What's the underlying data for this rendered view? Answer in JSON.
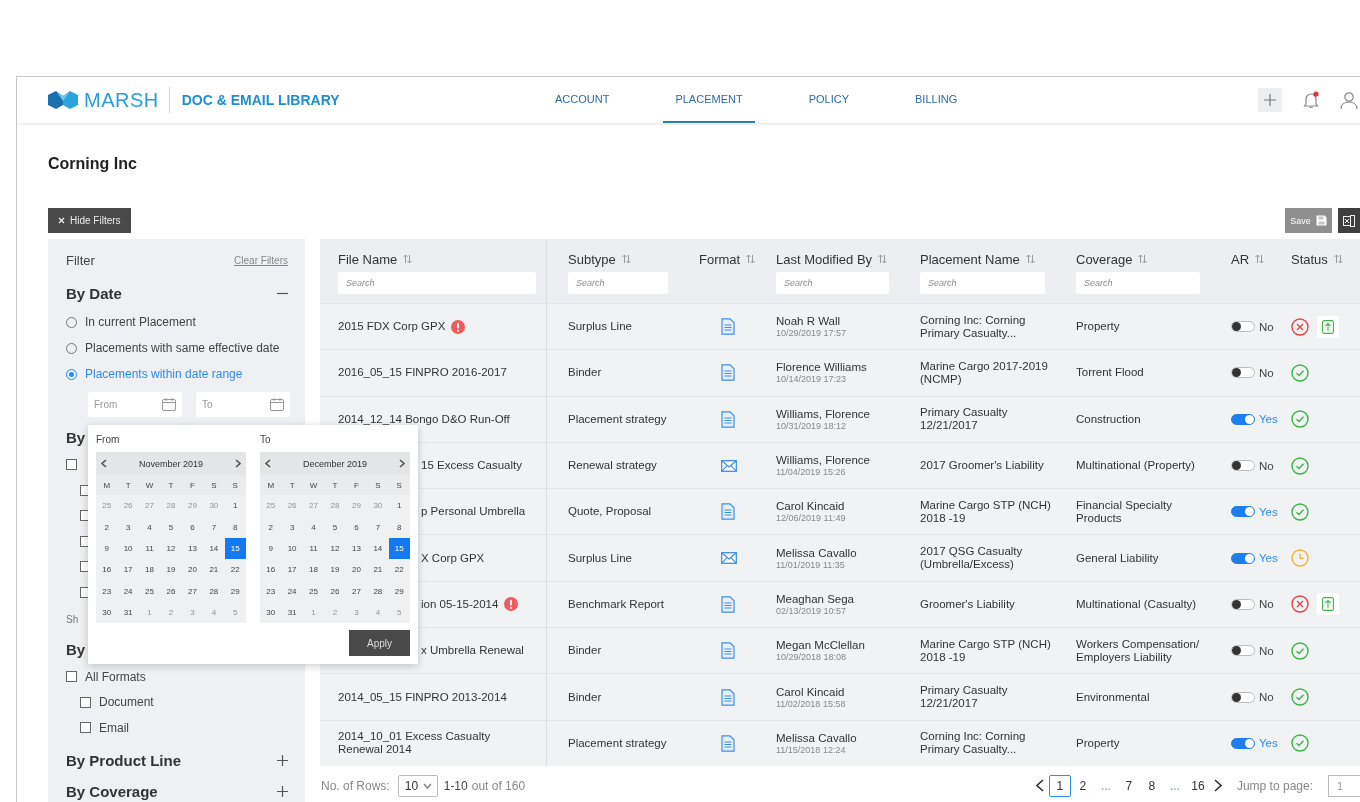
{
  "header": {
    "brand": "MARSH",
    "product": "DOC & EMAIL LIBRARY",
    "notifications": {
      "unread": true
    }
  },
  "nav": [
    {
      "label": "ACCOUNT",
      "selected": false
    },
    {
      "label": "PLACEMENT",
      "selected": true
    },
    {
      "label": "POLICY",
      "selected": false
    },
    {
      "label": "BILLING",
      "selected": false
    }
  ],
  "page_title": "Corning Inc",
  "toolbar": {
    "hide_filters": "Hide Filters",
    "save": {
      "label": "Save",
      "disabled": true
    }
  },
  "filters": {
    "title": "Filter",
    "clear": "Clear Filters",
    "sections": [
      {
        "kind": "radio",
        "title": "By Date",
        "expanded": true,
        "options": [
          {
            "label": "In current Placement",
            "selected": false
          },
          {
            "label": "Placements with same effective date",
            "selected": false
          },
          {
            "label": "Placements within date range",
            "selected": true
          }
        ],
        "range": {
          "from": {
            "placeholder": "From"
          },
          "to": {
            "placeholder": "To"
          }
        }
      },
      {
        "kind": "checkbox",
        "title": "By",
        "items": [
          {
            "checked": false,
            "children": [
              {
                "checked": false
              },
              {
                "checked": false
              },
              {
                "checked": false
              },
              {
                "checked": false
              },
              {
                "checked": false
              }
            ]
          }
        ],
        "more": "Sh"
      },
      {
        "kind": "checkbox",
        "title": "By",
        "items": [
          {
            "label": "All Formats",
            "checked": false,
            "children": [
              {
                "label": "Document",
                "checked": false
              },
              {
                "label": "Email",
                "checked": false
              }
            ]
          }
        ]
      },
      {
        "kind": "collapsed",
        "title": "By Product Line",
        "expanded": false
      },
      {
        "kind": "collapsed",
        "title": "By Coverage",
        "expanded": false
      }
    ]
  },
  "date_picker": {
    "calendars": [
      {
        "label": "From",
        "month": "November 2019",
        "weekdays": [
          "M",
          "T",
          "W",
          "T",
          "F",
          "S",
          "S"
        ],
        "weeks": [
          [
            {
              "day": "25",
              "muted": true,
              "selected": false
            },
            {
              "day": "26",
              "muted": true,
              "selected": false
            },
            {
              "day": "27",
              "muted": true,
              "selected": false
            },
            {
              "day": "28",
              "muted": true,
              "selected": false
            },
            {
              "day": "29",
              "muted": true,
              "selected": false
            },
            {
              "day": "30",
              "muted": true,
              "selected": false
            },
            {
              "day": "1",
              "muted": false,
              "selected": false
            }
          ],
          [
            {
              "day": "2",
              "muted": false,
              "selected": false
            },
            {
              "day": "3",
              "muted": false,
              "selected": false
            },
            {
              "day": "4",
              "muted": false,
              "selected": false
            },
            {
              "day": "5",
              "muted": false,
              "selected": false
            },
            {
              "day": "6",
              "muted": false,
              "selected": false
            },
            {
              "day": "7",
              "muted": false,
              "selected": false
            },
            {
              "day": "8",
              "muted": false,
              "selected": false
            }
          ],
          [
            {
              "day": "9",
              "muted": false,
              "selected": false
            },
            {
              "day": "10",
              "muted": false,
              "selected": false
            },
            {
              "day": "11",
              "muted": false,
              "selected": false
            },
            {
              "day": "12",
              "muted": false,
              "selected": false
            },
            {
              "day": "13",
              "muted": false,
              "selected": false
            },
            {
              "day": "14",
              "muted": false,
              "selected": false
            },
            {
              "day": "15",
              "muted": false,
              "selected": true
            }
          ],
          [
            {
              "day": "16",
              "muted": false,
              "selected": false
            },
            {
              "day": "17",
              "muted": false,
              "selected": false
            },
            {
              "day": "18",
              "muted": false,
              "selected": false
            },
            {
              "day": "19",
              "muted": false,
              "selected": false
            },
            {
              "day": "20",
              "muted": false,
              "selected": false
            },
            {
              "day": "21",
              "muted": false,
              "selected": false
            },
            {
              "day": "22",
              "muted": false,
              "selected": false
            }
          ],
          [
            {
              "day": "23",
              "muted": false,
              "selected": false
            },
            {
              "day": "24",
              "muted": false,
              "selected": false
            },
            {
              "day": "25",
              "muted": false,
              "selected": false
            },
            {
              "day": "26",
              "muted": false,
              "selected": false
            },
            {
              "day": "27",
              "muted": false,
              "selected": false
            },
            {
              "day": "28",
              "muted": false,
              "selected": false
            },
            {
              "day": "29",
              "muted": false,
              "selected": false
            }
          ],
          [
            {
              "day": "30",
              "muted": false,
              "selected": false
            },
            {
              "day": "31",
              "muted": false,
              "selected": false
            },
            {
              "day": "1",
              "muted": true,
              "selected": false
            },
            {
              "day": "2",
              "muted": true,
              "selected": false
            },
            {
              "day": "3",
              "muted": true,
              "selected": false
            },
            {
              "day": "4",
              "muted": true,
              "selected": false
            },
            {
              "day": "5",
              "muted": true,
              "selected": false
            }
          ]
        ]
      },
      {
        "label": "To",
        "month": "December 2019",
        "weekdays": [
          "M",
          "T",
          "W",
          "T",
          "F",
          "S",
          "S"
        ],
        "weeks": [
          [
            {
              "day": "25",
              "muted": true,
              "selected": false
            },
            {
              "day": "26",
              "muted": true,
              "selected": false
            },
            {
              "day": "27",
              "muted": true,
              "selected": false
            },
            {
              "day": "28",
              "muted": true,
              "selected": false
            },
            {
              "day": "29",
              "muted": true,
              "selected": false
            },
            {
              "day": "30",
              "muted": true,
              "selected": false
            },
            {
              "day": "1",
              "muted": false,
              "selected": false
            }
          ],
          [
            {
              "day": "2",
              "muted": false,
              "selected": false
            },
            {
              "day": "3",
              "muted": false,
              "selected": false
            },
            {
              "day": "4",
              "muted": false,
              "selected": false
            },
            {
              "day": "5",
              "muted": false,
              "selected": false
            },
            {
              "day": "6",
              "muted": false,
              "selected": false
            },
            {
              "day": "7",
              "muted": false,
              "selected": false
            },
            {
              "day": "8",
              "muted": false,
              "selected": false
            }
          ],
          [
            {
              "day": "9",
              "muted": false,
              "selected": false
            },
            {
              "day": "10",
              "muted": false,
              "selected": false
            },
            {
              "day": "11",
              "muted": false,
              "selected": false
            },
            {
              "day": "12",
              "muted": false,
              "selected": false
            },
            {
              "day": "13",
              "muted": false,
              "selected": false
            },
            {
              "day": "14",
              "muted": false,
              "selected": false
            },
            {
              "day": "15",
              "muted": false,
              "selected": true
            }
          ],
          [
            {
              "day": "16",
              "muted": false,
              "selected": false
            },
            {
              "day": "17",
              "muted": false,
              "selected": false
            },
            {
              "day": "18",
              "muted": false,
              "selected": false
            },
            {
              "day": "19",
              "muted": false,
              "selected": false
            },
            {
              "day": "20",
              "muted": false,
              "selected": false
            },
            {
              "day": "21",
              "muted": false,
              "selected": false
            },
            {
              "day": "22",
              "muted": false,
              "selected": false
            }
          ],
          [
            {
              "day": "23",
              "muted": false,
              "selected": false
            },
            {
              "day": "24",
              "muted": false,
              "selected": false
            },
            {
              "day": "25",
              "muted": false,
              "selected": false
            },
            {
              "day": "26",
              "muted": false,
              "selected": false
            },
            {
              "day": "27",
              "muted": false,
              "selected": false
            },
            {
              "day": "28",
              "muted": false,
              "selected": false
            },
            {
              "day": "29",
              "muted": false,
              "selected": false
            }
          ],
          [
            {
              "day": "30",
              "muted": false,
              "selected": false
            },
            {
              "day": "31",
              "muted": false,
              "selected": false
            },
            {
              "day": "1",
              "muted": true,
              "selected": false
            },
            {
              "day": "2",
              "muted": true,
              "selected": false
            },
            {
              "day": "3",
              "muted": true,
              "selected": false
            },
            {
              "day": "4",
              "muted": true,
              "selected": false
            },
            {
              "day": "5",
              "muted": true,
              "selected": false
            }
          ]
        ]
      }
    ],
    "apply": "Apply"
  },
  "table": {
    "columns": [
      {
        "label": "File Name",
        "placeholder": "Search"
      },
      {
        "label": "Subtype",
        "placeholder": "Search"
      },
      {
        "label": "Format"
      },
      {
        "label": "Last Modified By",
        "placeholder": "Search"
      },
      {
        "label": "Placement Name",
        "placeholder": "Search"
      },
      {
        "label": "Coverage",
        "placeholder": "Search"
      },
      {
        "label": "AR"
      },
      {
        "label": "Status"
      }
    ],
    "rows": [
      {
        "file": "2015 FDX Corp GPX",
        "alert": true,
        "covered": false,
        "subtype": "Surplus Line",
        "format": {
          "kind": "document"
        },
        "modified_by": "Noah R Wall",
        "modified_at": "10/29/2019 17:57",
        "placement": "Corning Inc: Corning Primary Casualty...",
        "coverage": "Property",
        "ar": {
          "on": false,
          "label": "No"
        },
        "status": {
          "kind": "error",
          "upload": true
        }
      },
      {
        "file": "2016_05_15 FINPRO 2016-2017",
        "alert": false,
        "covered": false,
        "subtype": "Binder",
        "format": {
          "kind": "document"
        },
        "modified_by": "Florence Williams",
        "modified_at": "10/14/2019 17:23",
        "placement": "Marine Cargo 2017-2019 (NCMP)",
        "coverage": "Torrent Flood",
        "ar": {
          "on": false,
          "label": "No"
        },
        "status": {
          "kind": "ok",
          "upload": false
        }
      },
      {
        "file": "2014_12_14 Bongo D&O Run-Off",
        "alert": false,
        "covered": false,
        "subtype": "Placement strategy",
        "format": {
          "kind": "document"
        },
        "modified_by": "Williams, Florence",
        "modified_at": "10/31/2019 18:12",
        "placement": "Primary Casualty 12/21/2017",
        "coverage": "Construction",
        "ar": {
          "on": true,
          "label": "Yes"
        },
        "status": {
          "kind": "ok",
          "upload": false
        }
      },
      {
        "file": "15 Excess Casualty",
        "alert": false,
        "covered": true,
        "subtype": "Renewal strategy",
        "format": {
          "kind": "email"
        },
        "modified_by": "Williams, Florence",
        "modified_at": "11/04/2019 15:26",
        "placement": "2017 Groomer's Liability",
        "coverage": "Multinational (Property)",
        "ar": {
          "on": false,
          "label": "No"
        },
        "status": {
          "kind": "ok",
          "upload": false
        }
      },
      {
        "file": "p Personal Umbrella",
        "alert": false,
        "covered": true,
        "subtype": "Quote, Proposal",
        "format": {
          "kind": "document"
        },
        "modified_by": "Carol Kincaid",
        "modified_at": "12/06/2019 11:49",
        "placement": "Marine Cargo STP (NCH) 2018 -19",
        "coverage": "Financial Specialty Products",
        "ar": {
          "on": true,
          "label": "Yes"
        },
        "status": {
          "kind": "ok",
          "upload": false
        }
      },
      {
        "file": "X Corp GPX",
        "alert": false,
        "covered": true,
        "subtype": "Surplus Line",
        "format": {
          "kind": "email"
        },
        "modified_by": "Melissa Cavallo",
        "modified_at": "11/01/2019 11:35",
        "placement": "2017 QSG Casualty (Umbrella/Excess)",
        "coverage": "General Liability",
        "ar": {
          "on": true,
          "label": "Yes"
        },
        "status": {
          "kind": "pending",
          "upload": false
        }
      },
      {
        "file": "ion 05-15-2014",
        "alert": true,
        "covered": true,
        "subtype": "Benchmark Report",
        "format": {
          "kind": "document"
        },
        "modified_by": "Meaghan Sega",
        "modified_at": "02/13/2019 10:57",
        "placement": "Groomer's Liability",
        "coverage": "Multinational (Casualty)",
        "ar": {
          "on": false,
          "label": "No"
        },
        "status": {
          "kind": "error",
          "upload": true
        }
      },
      {
        "file": "x Umbrella Renewal",
        "alert": false,
        "covered": true,
        "subtype": "Binder",
        "format": {
          "kind": "document"
        },
        "modified_by": "Megan McClellan",
        "modified_at": "10/29/2018 18:08",
        "placement": "Marine Cargo STP (NCH) 2018 -19",
        "coverage": "Workers Compensation/ Employers Liability",
        "ar": {
          "on": false,
          "label": "No"
        },
        "status": {
          "kind": "ok",
          "upload": false
        }
      },
      {
        "file": "2014_05_15 FINPRO 2013-2014",
        "alert": false,
        "covered": false,
        "subtype": "Binder",
        "format": {
          "kind": "document"
        },
        "modified_by": "Carol Kincaid",
        "modified_at": "11/02/2018 15:58",
        "placement": "Primary Casualty 12/21/2017",
        "coverage": "Environmental",
        "ar": {
          "on": false,
          "label": "No"
        },
        "status": {
          "kind": "ok",
          "upload": false
        }
      },
      {
        "file": "2014_10_01 Excess Casualty Renewal 2014",
        "alert": false,
        "covered": false,
        "subtype": "Placement strategy",
        "format": {
          "kind": "document"
        },
        "modified_by": "Melissa Cavallo",
        "modified_at": "11/15/2018 12:24",
        "placement": "Corning Inc: Corning Primary Casualty...",
        "coverage": "Property",
        "ar": {
          "on": true,
          "label": "Yes"
        },
        "status": {
          "kind": "ok",
          "upload": false
        }
      }
    ]
  },
  "pagination": {
    "rows_label": "No. of Rows:",
    "rows_value": "10",
    "range": "1-10",
    "total": "out of 160",
    "pages": [
      {
        "label": "1",
        "kind": "page",
        "selected": true
      },
      {
        "label": "2",
        "kind": "page",
        "selected": false
      },
      {
        "label": "...",
        "kind": "ellipsis",
        "selected": false
      },
      {
        "label": "7",
        "kind": "page",
        "selected": false
      },
      {
        "label": "8",
        "kind": "page",
        "selected": false
      },
      {
        "label": "...",
        "kind": "ellipsis",
        "selected": false
      },
      {
        "label": "16",
        "kind": "page",
        "selected": false
      }
    ],
    "jump_label": "Jump to page:",
    "jump_placeholder": "1"
  }
}
